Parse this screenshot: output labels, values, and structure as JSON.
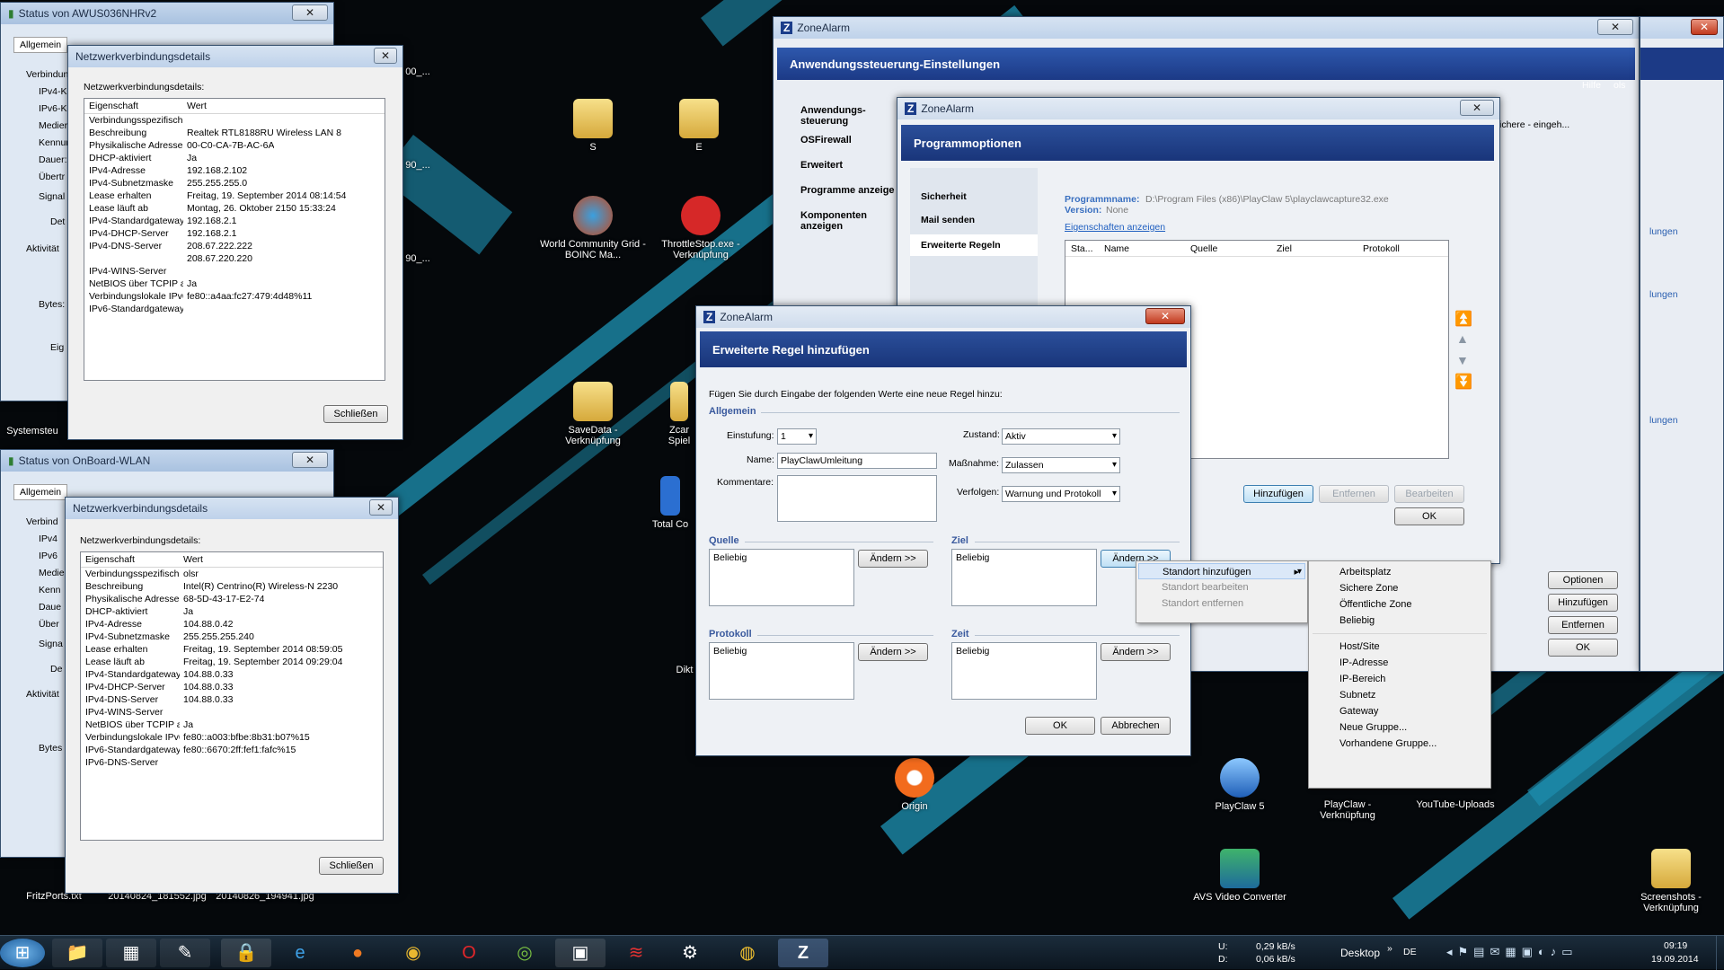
{
  "desktop": {
    "icons": [
      {
        "label": "S"
      },
      {
        "label": "E"
      },
      {
        "label": "World Community Grid - BOINC Ma..."
      },
      {
        "label": "ThrottleStop.exe - Verknüpfung"
      },
      {
        "label": "SaveData - Verknüpfung"
      },
      {
        "label": "Zcar Spiel"
      },
      {
        "label": "Total Co"
      },
      {
        "label": "Dikt"
      },
      {
        "label": "Origin"
      },
      {
        "label": "PlayClaw 5"
      },
      {
        "label": "PlayClaw - Verknüpfung"
      },
      {
        "label": "YouTube-Uploads"
      },
      {
        "label": "AVS Video Converter"
      },
      {
        "label": "Screenshots - Verknüpfung"
      },
      {
        "label": "Systemsteu"
      },
      {
        "label": "FritzPorts.txt"
      },
      {
        "label": "20140824_181552.jpg"
      },
      {
        "label": "20140826_194941.jpg"
      },
      {
        "label": "90_..."
      },
      {
        "label": "90_..."
      },
      {
        "label": "00_..."
      }
    ]
  },
  "status_awus": {
    "title": "Status von AWUS036NHRv2",
    "tab": "Allgemein",
    "fragments": [
      "Verbindun",
      "IPv4-K",
      "IPv6-K",
      "Medier",
      "Kennun",
      "Dauer:",
      "Übertr",
      "Signal",
      "Det",
      "Aktivität",
      "Bytes:",
      "Eig"
    ]
  },
  "details1": {
    "title": "Netzwerkverbindungsdetails",
    "heading": "Netzwerkverbindungsdetails:",
    "col_property": "Eigenschaft",
    "col_value": "Wert",
    "rows": [
      [
        "Verbindungsspezifisches...",
        ""
      ],
      [
        "Beschreibung",
        "Realtek RTL8188RU Wireless LAN 8"
      ],
      [
        "Physikalische Adresse",
        "00-C0-CA-7B-AC-6A"
      ],
      [
        "DHCP-aktiviert",
        "Ja"
      ],
      [
        "IPv4-Adresse",
        "192.168.2.102"
      ],
      [
        "IPv4-Subnetzmaske",
        "255.255.255.0"
      ],
      [
        "Lease erhalten",
        "Freitag, 19. September 2014 08:14:54"
      ],
      [
        "Lease läuft ab",
        "Montag, 26. Oktober 2150 15:33:24"
      ],
      [
        "IPv4-Standardgateway",
        "192.168.2.1"
      ],
      [
        "IPv4-DHCP-Server",
        "192.168.2.1"
      ],
      [
        "IPv4-DNS-Server",
        "208.67.222.222"
      ],
      [
        "",
        "208.67.220.220"
      ],
      [
        "IPv4-WINS-Server",
        ""
      ],
      [
        "NetBIOS über TCPIP ak...",
        "Ja"
      ],
      [
        "Verbindungslokale IPv6-...",
        "fe80::a4aa:fc27:479:4d48%11"
      ],
      [
        "IPv6-Standardgateway",
        ""
      ]
    ],
    "close_label": "Schließen"
  },
  "status_onboard": {
    "title": "Status von OnBoard-WLAN",
    "tab": "Allgemein",
    "fragments": [
      "Verbind",
      "IPv4",
      "IPv6",
      "Medie",
      "Kenn",
      "Daue",
      "Über",
      "Signa",
      "De",
      "Aktivität",
      "Bytes"
    ]
  },
  "details2": {
    "title": "Netzwerkverbindungsdetails",
    "heading": "Netzwerkverbindungsdetails:",
    "col_property": "Eigenschaft",
    "col_value": "Wert",
    "rows": [
      [
        "Verbindungsspezifisches...",
        "olsr"
      ],
      [
        "Beschreibung",
        "Intel(R) Centrino(R) Wireless-N 2230"
      ],
      [
        "Physikalische Adresse",
        "68-5D-43-17-E2-74"
      ],
      [
        "DHCP-aktiviert",
        "Ja"
      ],
      [
        "IPv4-Adresse",
        "104.88.0.42"
      ],
      [
        "IPv4-Subnetzmaske",
        "255.255.255.240"
      ],
      [
        "Lease erhalten",
        "Freitag, 19. September 2014 08:59:05"
      ],
      [
        "Lease läuft ab",
        "Freitag, 19. September 2014 09:29:04"
      ],
      [
        "IPv4-Standardgateway",
        "104.88.0.33"
      ],
      [
        "IPv4-DHCP-Server",
        "104.88.0.33"
      ],
      [
        "IPv4-DNS-Server",
        "104.88.0.33"
      ],
      [
        "IPv4-WINS-Server",
        ""
      ],
      [
        "NetBIOS über TCPIP ak...",
        "Ja"
      ],
      [
        "Verbindungslokale IPv6-...",
        "fe80::a003:bfbe:8b31:b07%15"
      ],
      [
        "IPv6-Standardgateway",
        "fe80::6670:2ff:fef1:fafc%15"
      ],
      [
        "IPv6-DNS-Server",
        ""
      ]
    ],
    "close_label": "Schließen"
  },
  "za_main": {
    "title": "ZoneAlarm",
    "header": "Anwendungssteuerung-Einstellungen",
    "nav": [
      "Anwendungs- steuerung",
      "OSFirewall",
      "Erweitert",
      "Programme anzeige",
      "Komponenten anzeigen"
    ],
    "right_frag": [
      "ols",
      "Hilfe",
      "ichere - eingeh...",
      "lungen",
      "lungen",
      "lungen"
    ],
    "buttons": [
      "Optionen",
      "Hinzufügen",
      "Entfernen",
      "OK"
    ]
  },
  "za_prog": {
    "title": "ZoneAlarm",
    "header": "Programmoptionen",
    "nav": [
      "Sicherheit",
      "Mail senden",
      "Erweiterte Regeln"
    ],
    "program_label": "Programmname:",
    "program_value": "D:\\Program Files (x86)\\PlayClaw 5\\playclawcapture32.exe",
    "version_label": "Version:",
    "version_value": "None",
    "link": "Eigenschaften anzeigen",
    "columns": [
      "Sta...",
      "Name",
      "Quelle",
      "Ziel",
      "Protokoll"
    ],
    "buttons": [
      "Hinzufügen",
      "Entfernen",
      "Bearbeiten",
      "OK"
    ]
  },
  "za_rule": {
    "title": "ZoneAlarm",
    "header": "Erweiterte Regel hinzufügen",
    "intro": "Fügen Sie durch Eingabe der folgenden Werte eine neue Regel hinzu:",
    "group_general": "Allgemein",
    "rank_label": "Einstufung:",
    "rank_value": "1",
    "name_label": "Name:",
    "name_value": "PlayClawUmleitung",
    "comments_label": "Kommentare:",
    "state_label": "Zustand:",
    "state_value": "Aktiv",
    "action_label": "Maßnahme:",
    "action_value": "Zulassen",
    "track_label": "Verfolgen:",
    "track_value": "Warnung und Protokoll",
    "group_source": "Quelle",
    "source_value": "Beliebig",
    "group_dest": "Ziel",
    "dest_value": "Beliebig",
    "group_protocol": "Protokoll",
    "protocol_value": "Beliebig",
    "group_time": "Zeit",
    "time_value": "Beliebig",
    "change_label": "Ändern >>",
    "ok_label": "OK",
    "cancel_label": "Abbrechen"
  },
  "context_menu": {
    "items": [
      "Standort hinzufügen",
      "Standort bearbeiten",
      "Standort entfernen"
    ]
  },
  "submenu": {
    "group1": [
      "Arbeitsplatz",
      "Sichere Zone",
      "Öffentliche Zone",
      "Beliebig"
    ],
    "group2": [
      "Host/Site",
      "IP-Adresse",
      "IP-Bereich",
      "Subnetz",
      "Gateway",
      "Neue Gruppe...",
      "Vorhandene Gruppe..."
    ]
  },
  "taskbar": {
    "net_up_label": "U:",
    "net_up": "0,29 kB/s",
    "net_down_label": "D:",
    "net_down": "0,06 kB/s",
    "desktop_label": "Desktop",
    "lang": "DE",
    "time": "09:19",
    "date": "19.09.2014"
  },
  "colors": {
    "accent": "#1e93b5",
    "za_header": "#1f3f88"
  }
}
